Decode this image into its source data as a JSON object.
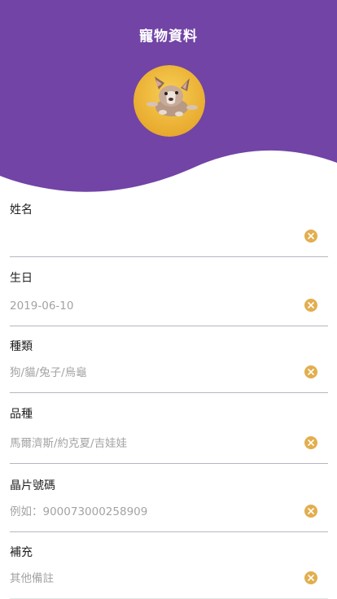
{
  "header": {
    "title": "寵物資料",
    "colors": {
      "header_bg": "#7244a6",
      "accent": "#e2ae4e"
    },
    "avatar_icon": "pet-photo-french-bulldog"
  },
  "form": {
    "fields": [
      {
        "label": "姓名",
        "value": "",
        "placeholder": ""
      },
      {
        "label": "生日",
        "value": "",
        "placeholder": "2019-06-10"
      },
      {
        "label": "種類",
        "value": "",
        "placeholder": "狗/貓/兔子/烏龜"
      },
      {
        "label": "品種",
        "value": "",
        "placeholder": "馬爾濟斯/約克夏/吉娃娃"
      },
      {
        "label": "晶片號碼",
        "value": "",
        "placeholder": "例如：900073000258909"
      },
      {
        "label": "補充",
        "value": "",
        "placeholder": "其他備註"
      }
    ],
    "clear_icon": "clear-circle-x-icon"
  }
}
